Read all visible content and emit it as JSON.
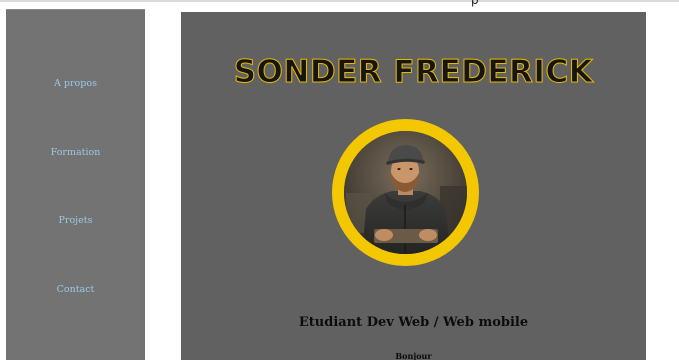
{
  "header_fragment": "p",
  "nav": {
    "items": [
      {
        "label": "A propos"
      },
      {
        "label": "Formation"
      },
      {
        "label": "Projets"
      },
      {
        "label": "Contact"
      }
    ]
  },
  "main": {
    "title": "SONDER FREDERICK",
    "subtitle": "Etudiant Dev Web / Web mobile",
    "greeting": "Bonjour"
  },
  "colors": {
    "sidebar_bg": "#737373",
    "main_bg": "#616161",
    "nav_link": "#9cc7e4",
    "accent_ring": "#f4c800",
    "title_fill": "#151515"
  },
  "icons": {
    "portrait": "profile-photo"
  }
}
